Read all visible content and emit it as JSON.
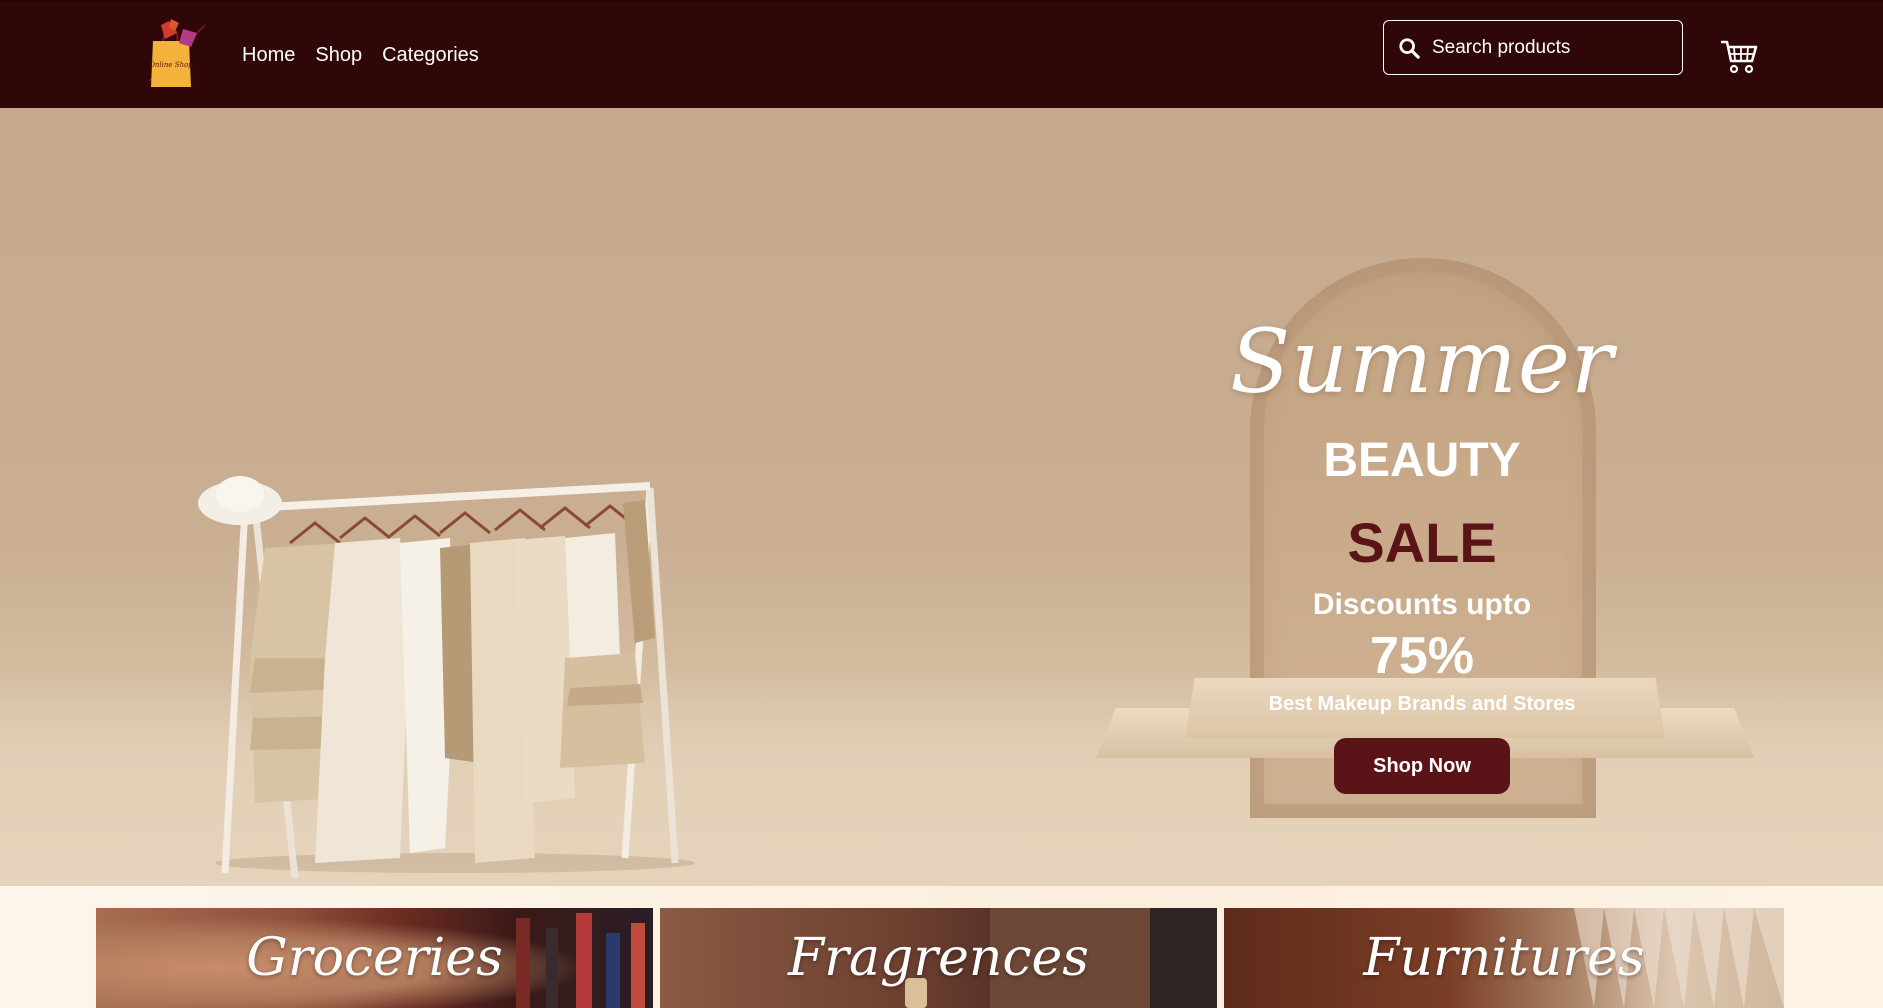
{
  "navbar": {
    "logo_text": "Online Shop",
    "links": [
      "Home",
      "Shop",
      "Categories"
    ],
    "search": {
      "placeholder": "Search products",
      "icon": "search-icon"
    },
    "cart_icon": "cart-icon",
    "background": "#2f0709"
  },
  "hero": {
    "script_title": "Summer",
    "headline": "BEAUTY",
    "headline_accent": "SALE",
    "discount_text": "Discounts upto",
    "discount_value": "75%",
    "subline": "Best Makeup Brands and Stores",
    "cta_label": "Shop Now",
    "accent_color": "#5a1418"
  },
  "categories": [
    {
      "label": "Groceries"
    },
    {
      "label": "Fragrences"
    },
    {
      "label": "Furnitures"
    }
  ]
}
